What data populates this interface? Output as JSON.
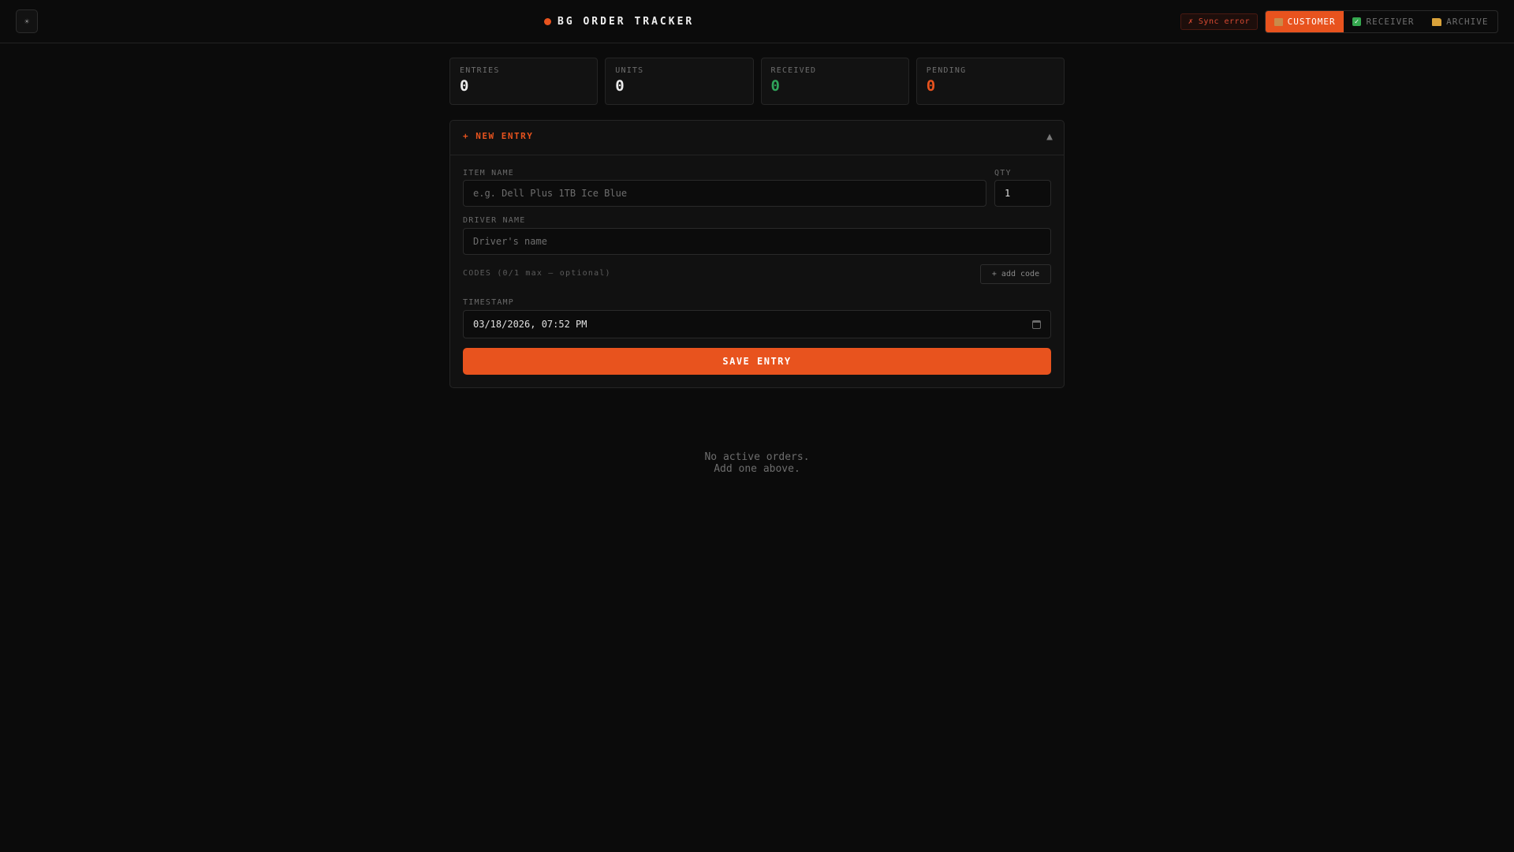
{
  "header": {
    "theme_toggle_glyph": "☀",
    "title": "BG ORDER TRACKER",
    "sync_status": "✗ Sync error",
    "tabs": [
      {
        "label": "CUSTOMER",
        "icon": "package-icon",
        "active": true
      },
      {
        "label": "RECEIVER",
        "icon": "check-icon",
        "active": false
      },
      {
        "label": "ARCHIVE",
        "icon": "folder-icon",
        "active": false
      }
    ]
  },
  "stats": [
    {
      "label": "ENTRIES",
      "value": "0"
    },
    {
      "label": "UNITS",
      "value": "0"
    },
    {
      "label": "RECEIVED",
      "value": "0",
      "color": "#2fa35a"
    },
    {
      "label": "PENDING",
      "value": "0",
      "color": "#e8531e"
    }
  ],
  "form": {
    "title": "+ NEW ENTRY",
    "collapse_glyph": "▲",
    "item_label": "ITEM NAME",
    "item_placeholder": "e.g. Dell Plus 1TB Ice Blue",
    "qty_label": "QTY",
    "qty_value": "1",
    "driver_label": "DRIVER NAME",
    "driver_placeholder": "Driver's name",
    "codes_label": "CODES (0/1 max — optional)",
    "add_code_label": "+ add code",
    "timestamp_label": "TIMESTAMP",
    "timestamp_value": "03/18/2026, 07:52 PM",
    "save_label": "SAVE ENTRY"
  },
  "empty_state": {
    "line1": "No active orders.",
    "line2": "Add one above."
  },
  "colors": {
    "accent": "#e8531e",
    "success": "#2fa35a",
    "error": "#d94a32",
    "background": "#0b0b0b"
  }
}
